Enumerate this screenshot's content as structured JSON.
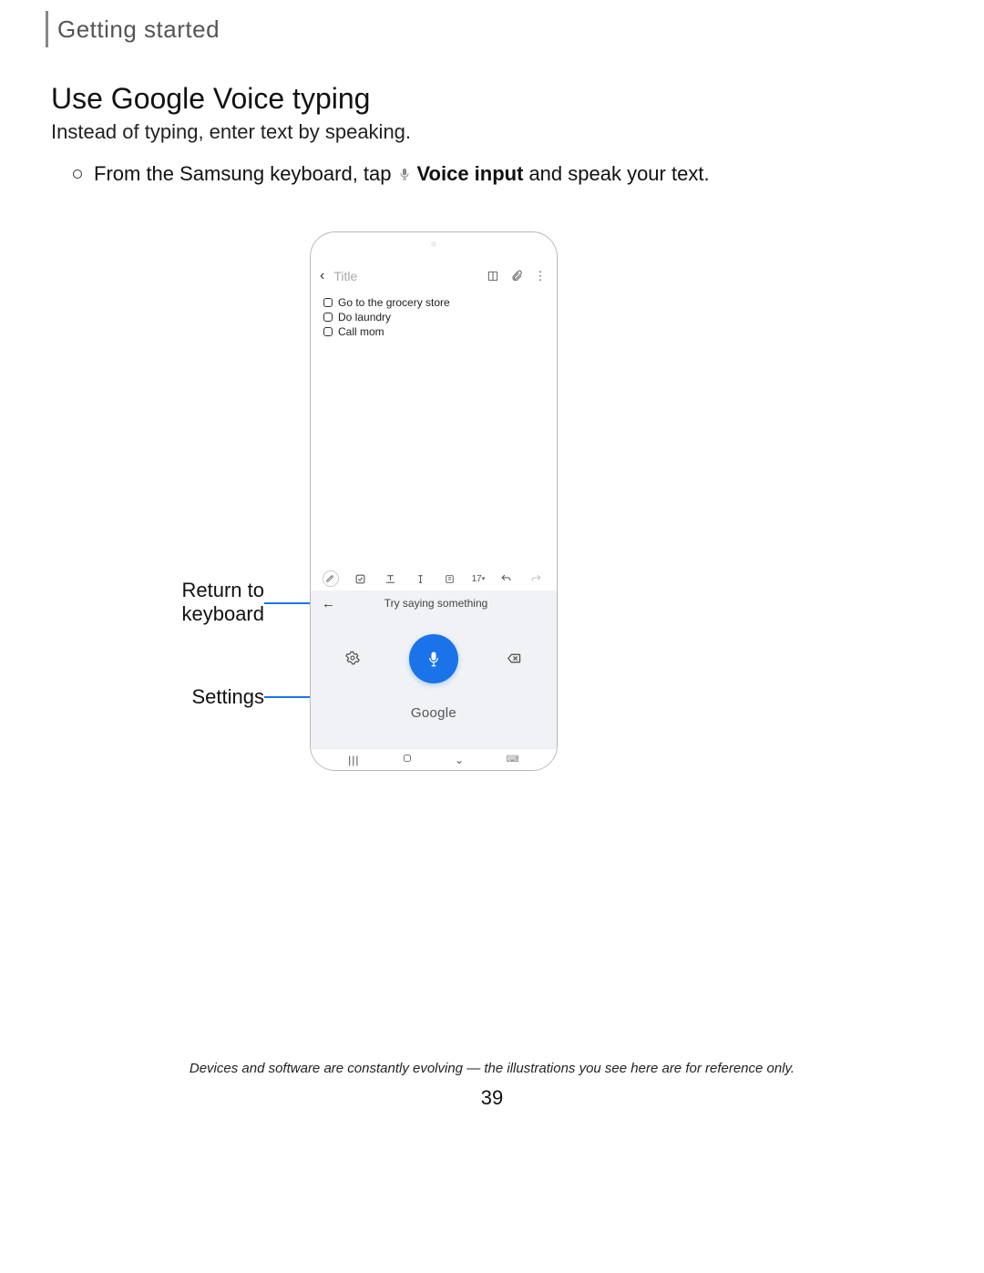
{
  "section": "Getting started",
  "heading": "Use Google Voice typing",
  "intro": "Instead of typing, enter text by speaking.",
  "instruction": {
    "pre": "From the Samsung keyboard, tap",
    "label": "Voice input",
    "post": "and speak your text."
  },
  "callouts": {
    "return": "Return to keyboard",
    "settings": "Settings"
  },
  "phone": {
    "title_placeholder": "Title",
    "notes": [
      "Go to the grocery store",
      "Do laundry",
      "Call mom"
    ],
    "toolbar_fontsize": "17",
    "voice_prompt": "Try saying something",
    "brand": "Google"
  },
  "footer": "Devices and software are constantly evolving — the illustrations you see here are for reference only.",
  "page_number": "39"
}
